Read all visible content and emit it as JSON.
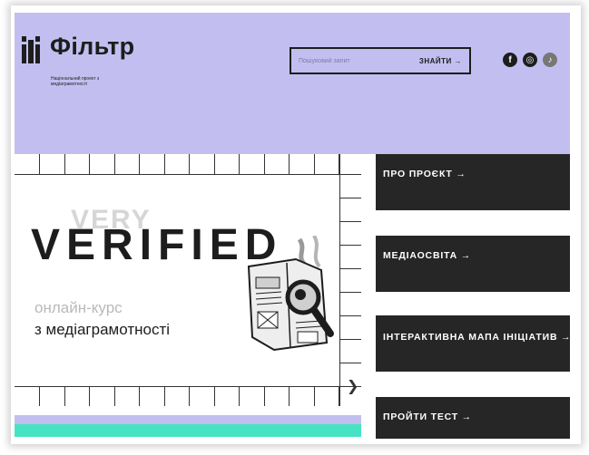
{
  "logo": {
    "name": "Фільтр",
    "subtitle": "Національний проект з медіаграмотності"
  },
  "search": {
    "placeholder": "Пошуковий запит",
    "button_label": "ЗНАЙТИ →"
  },
  "socials": [
    {
      "icon": "facebook-icon",
      "glyph": "f"
    },
    {
      "icon": "instagram-icon",
      "glyph": "◎"
    },
    {
      "icon": "tiktok-icon",
      "glyph": "♪"
    }
  ],
  "banner": {
    "ghost_word": "VERY",
    "headline": "VERIFIED",
    "line1": "онлайн-курс",
    "line2": "з медіаграмотності",
    "next_glyph": "❯"
  },
  "nav": [
    {
      "label": "ПРО ПРОЄКТ →"
    },
    {
      "label": "МЕДІАОСВІТА →"
    },
    {
      "label": "ІНТЕРАКТИВНА МАПА ІНІЦІАТИВ →"
    },
    {
      "label": "ПРОЙТИ ТЕСТ →"
    }
  ],
  "colors": {
    "header_bg": "#c2bff0",
    "nav_bg": "#262626",
    "accent_green": "#48e3c3",
    "text_dark": "#1d1d1d"
  }
}
